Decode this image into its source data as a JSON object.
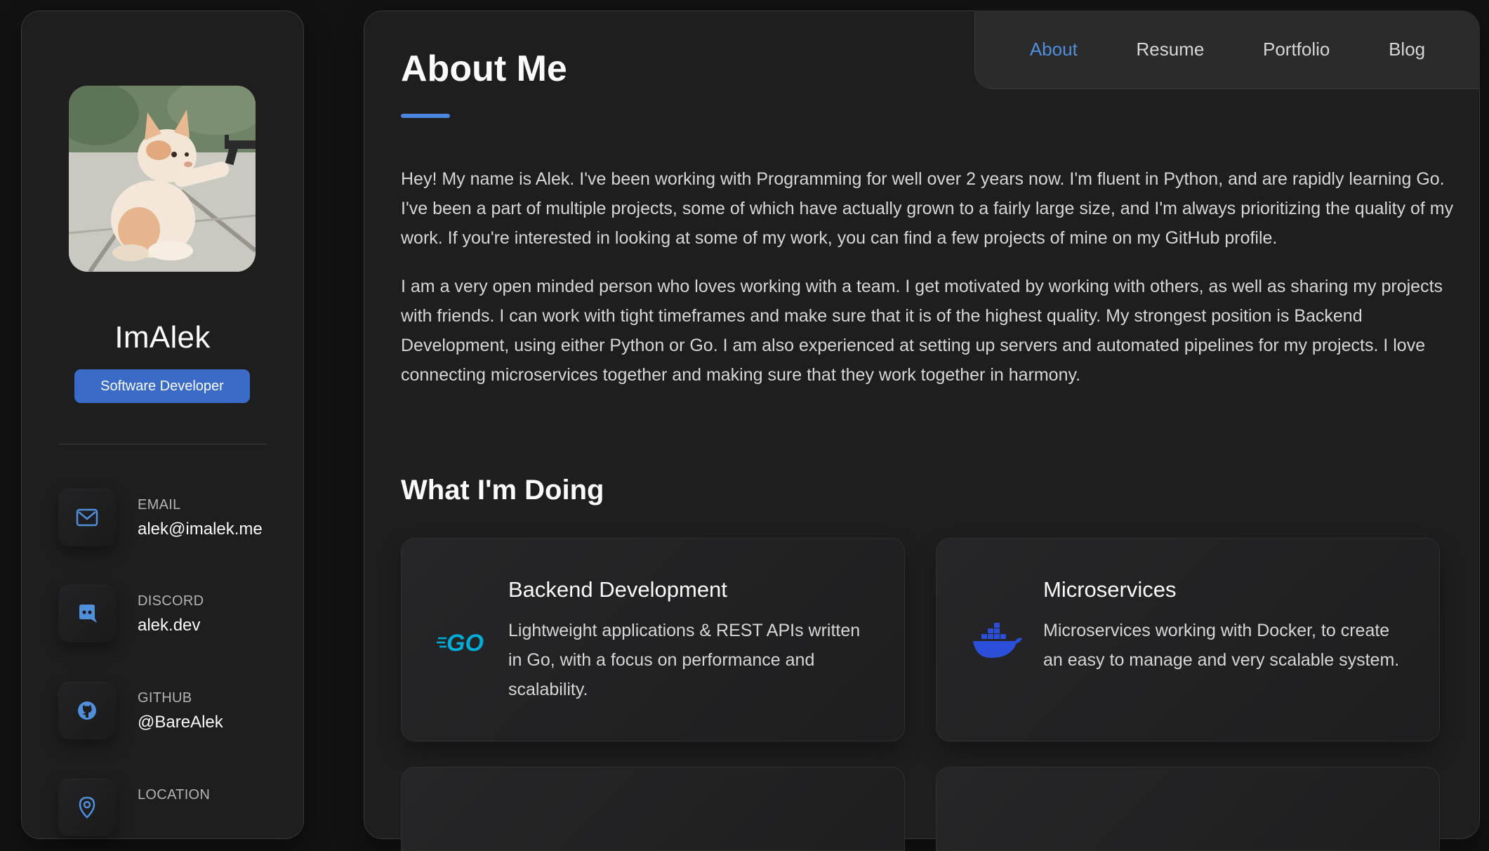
{
  "profile": {
    "name": "ImAlek",
    "title": "Software Developer"
  },
  "contacts": [
    {
      "label": "EMAIL",
      "value": "alek@imalek.me",
      "icon": "mail-icon"
    },
    {
      "label": "DISCORD",
      "value": "alek.dev",
      "icon": "discord-icon"
    },
    {
      "label": "GITHUB",
      "value": "@BareAlek",
      "icon": "github-icon"
    },
    {
      "label": "LOCATION",
      "value": "",
      "icon": "location-pin-icon"
    }
  ],
  "nav": {
    "items": [
      "About",
      "Resume",
      "Portfolio",
      "Blog"
    ],
    "active": "About"
  },
  "about": {
    "title": "About Me",
    "paragraphs": [
      "Hey! My name is Alek. I've been working with Programming for well over 2 years now. I'm fluent in Python, and are rapidly learning Go. I've been a part of multiple projects, some of which have actually grown to a fairly large size, and I'm always prioritizing the quality of my work. If you're interested in looking at some of my work, you can find a few projects of mine on my GitHub profile.",
      "I am a very open minded person who loves working with a team. I get motivated by working with others, as well as sharing my projects with friends. I can work with tight timeframes and make sure that it is of the highest quality. My strongest position is Backend Development, using either Python or Go. I am also experienced at setting up servers and automated pipelines for my projects. I love connecting microservices together and making sure that they work together in harmony."
    ]
  },
  "services": {
    "title": "What I'm Doing",
    "items": [
      {
        "title": "Backend Development",
        "text": "Lightweight applications & REST APIs written in Go, with a focus on performance and scalability.",
        "icon": "go-logo-icon",
        "logo_text": "GO"
      },
      {
        "title": "Microservices",
        "text": "Microservices working with Docker, to create an easy to manage and very scalable system.",
        "icon": "docker-whale-icon"
      }
    ]
  },
  "colors": {
    "accent": "#4a86dd",
    "badge": "#3a6cc7",
    "go_cyan": "#00add8",
    "docker_blue": "#2b4fd8"
  }
}
